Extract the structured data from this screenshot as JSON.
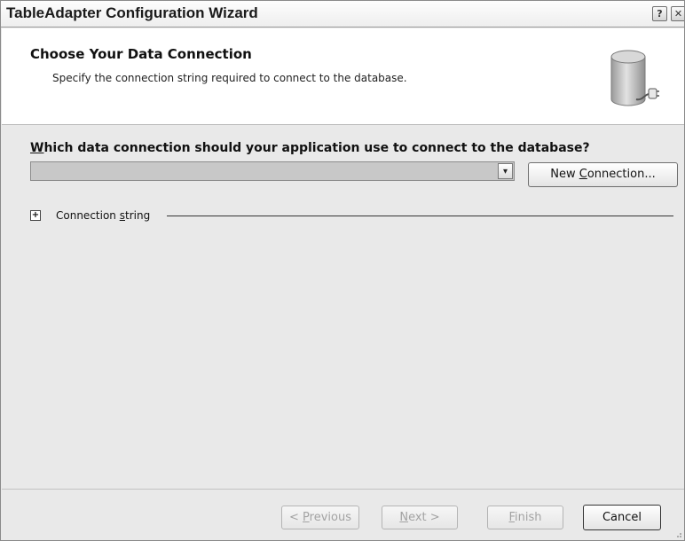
{
  "window": {
    "title": "TableAdapter Configuration Wizard",
    "help_button": "?",
    "close_button": "✕"
  },
  "header": {
    "title": "Choose Your Data Connection",
    "subtitle": "Specify the connection string required to connect to the database.",
    "icon": "database-connection-icon"
  },
  "main": {
    "question_first": "W",
    "question_rest": "hich data connection should your application use to connect to the database?",
    "connection_combo": {
      "selected_value": "",
      "arrow": "▾"
    },
    "new_connection_prefix": "New ",
    "new_connection_underline": "C",
    "new_connection_suffix": "onnection...",
    "expander_symbol": "+",
    "connection_string_prefix": "Connection ",
    "connection_string_underline": "s",
    "connection_string_suffix": "tring"
  },
  "footer": {
    "previous_prefix": "< ",
    "previous_underline": "P",
    "previous_suffix": "revious",
    "next_underline": "N",
    "next_suffix": "ext >",
    "finish_underline": "F",
    "finish_suffix": "inish",
    "cancel_label": "Cancel"
  }
}
